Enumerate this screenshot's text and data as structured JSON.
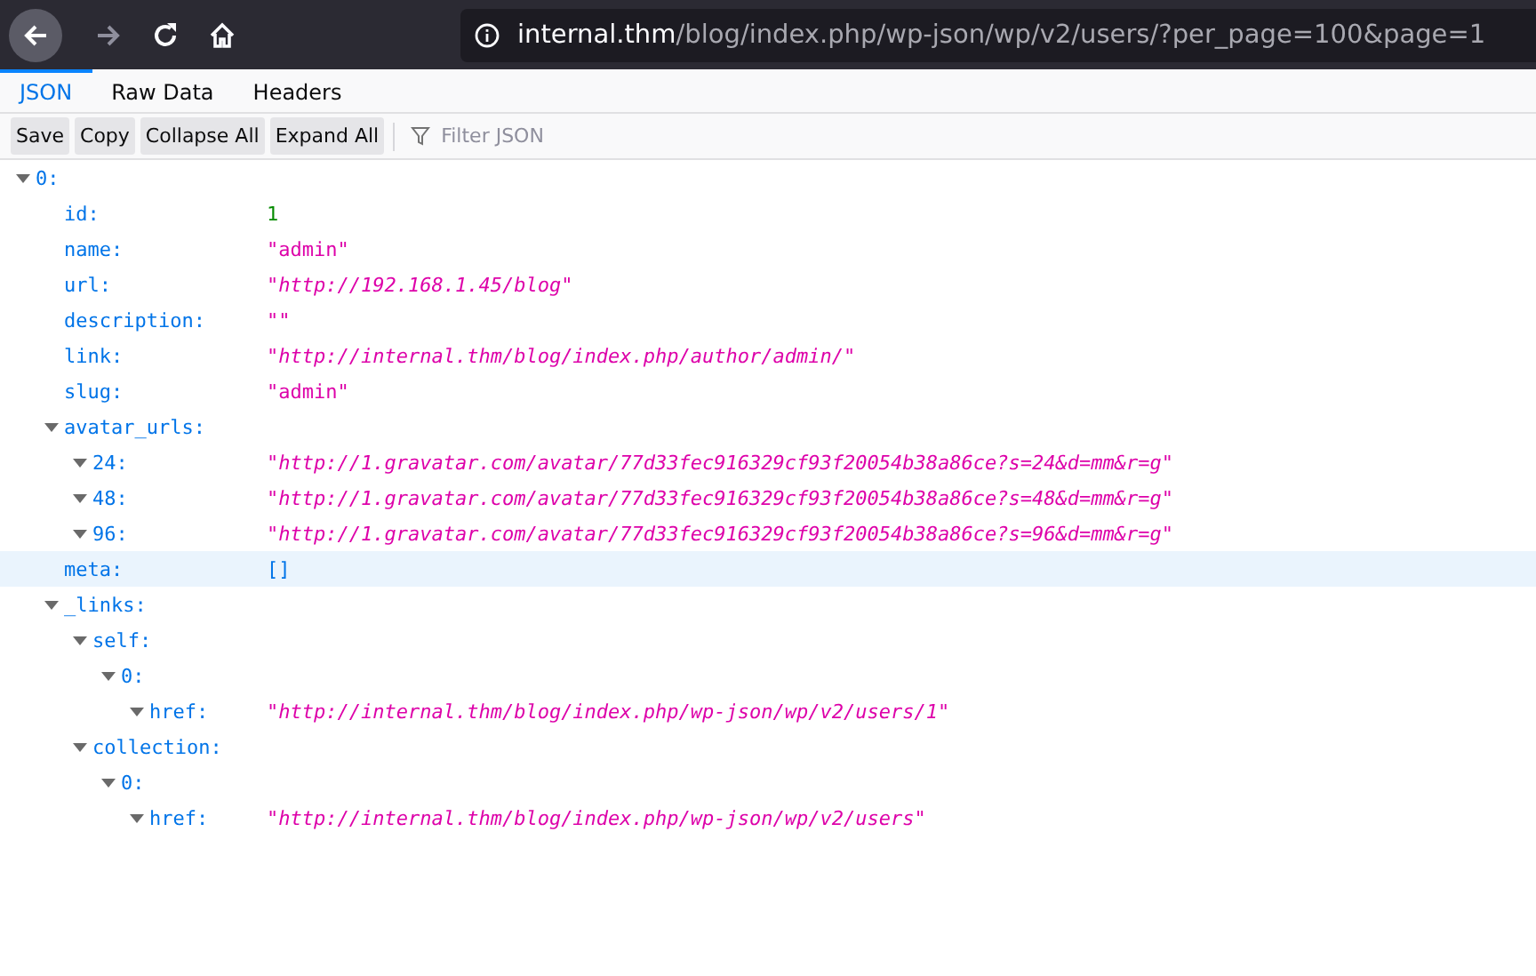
{
  "browser": {
    "url_host": "internal.thm",
    "url_path": "/blog/index.php/wp-json/wp/v2/users/?per_page=100&page=1"
  },
  "tabs": [
    {
      "label": "JSON",
      "selected": true
    },
    {
      "label": "Raw Data",
      "selected": false
    },
    {
      "label": "Headers",
      "selected": false
    }
  ],
  "toolbar": {
    "buttons": [
      "Save",
      "Copy",
      "Collapse All",
      "Expand All"
    ],
    "filter": {
      "placeholder": "Filter JSON"
    }
  },
  "tree": [
    {
      "key": "0:",
      "expanded": true,
      "selected": false,
      "children": [
        {
          "key": "id:",
          "value": "1",
          "kind": "number",
          "selected": false
        },
        {
          "key": "name:",
          "value": "\"admin\"",
          "kind": "string",
          "selected": false
        },
        {
          "key": "url:",
          "value": "\"http://192.168.1.45/blog\"",
          "kind": "url",
          "selected": false
        },
        {
          "key": "description:",
          "value": "\"\"",
          "kind": "string",
          "selected": false
        },
        {
          "key": "link:",
          "value": "\"http://internal.thm/blog/index.php/author/admin/\"",
          "kind": "url",
          "selected": false
        },
        {
          "key": "slug:",
          "value": "\"admin\"",
          "kind": "string",
          "selected": false
        },
        {
          "key": "avatar_urls:",
          "expanded": true,
          "selected": false,
          "children": [
            {
              "key": "24:",
              "expanded": true,
              "value": "\"http://1.gravatar.com/avatar/77d33fec916329cf93f20054b38a86ce?s=24&d=mm&r=g\"",
              "kind": "url",
              "selected": false
            },
            {
              "key": "48:",
              "expanded": true,
              "value": "\"http://1.gravatar.com/avatar/77d33fec916329cf93f20054b38a86ce?s=48&d=mm&r=g\"",
              "kind": "url",
              "selected": false
            },
            {
              "key": "96:",
              "expanded": true,
              "value": "\"http://1.gravatar.com/avatar/77d33fec916329cf93f20054b38a86ce?s=96&d=mm&r=g\"",
              "kind": "url",
              "selected": false
            }
          ]
        },
        {
          "key": "meta:",
          "value": "[]",
          "kind": "array",
          "selected": true
        },
        {
          "key": "_links:",
          "expanded": true,
          "selected": false,
          "children": [
            {
              "key": "self:",
              "expanded": true,
              "selected": false,
              "children": [
                {
                  "key": "0:",
                  "expanded": true,
                  "selected": false,
                  "children": [
                    {
                      "key": "href:",
                      "expanded": true,
                      "value": "\"http://internal.thm/blog/index.php/wp-json/wp/v2/users/1\"",
                      "kind": "url",
                      "selected": false
                    }
                  ]
                }
              ]
            },
            {
              "key": "collection:",
              "expanded": true,
              "selected": false,
              "children": [
                {
                  "key": "0:",
                  "expanded": true,
                  "selected": false,
                  "children": [
                    {
                      "key": "href:",
                      "expanded": true,
                      "value": "\"http://internal.thm/blog/index.php/wp-json/wp/v2/users\"",
                      "kind": "url",
                      "selected": false
                    }
                  ]
                }
              ]
            }
          ]
        }
      ]
    }
  ]
}
